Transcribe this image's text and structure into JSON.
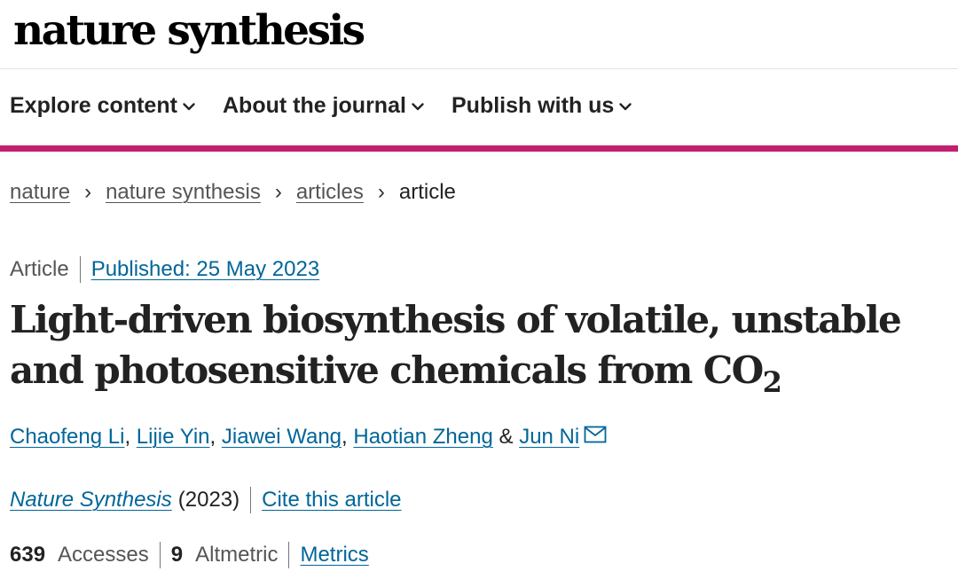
{
  "brand": {
    "logo_text": "nature synthesis"
  },
  "nav": {
    "items": [
      {
        "label": "Explore content",
        "icon": "chevron-down-icon"
      },
      {
        "label": "About the journal",
        "icon": "chevron-down-icon"
      },
      {
        "label": "Publish with us",
        "icon": "chevron-down-icon"
      }
    ]
  },
  "colors": {
    "accent_rule": "#c1206f",
    "link": "#006699",
    "text": "#222222",
    "muted": "#555555"
  },
  "breadcrumb": {
    "items": [
      "nature",
      "nature synthesis",
      "articles"
    ],
    "current": "article",
    "separator": "›"
  },
  "article": {
    "type": "Article",
    "published": "Published: 25 May 2023",
    "title_main": "Light-driven biosynthesis of volatile, unstable and photosensitive chemicals from CO",
    "title_subscript": "2",
    "authors": [
      {
        "name": "Chaofeng Li",
        "after": ","
      },
      {
        "name": "Lijie Yin",
        "after": ","
      },
      {
        "name": "Jiawei Wang",
        "after": ","
      },
      {
        "name": "Haotian Zheng",
        "after": ""
      }
    ],
    "ampersand": "&",
    "corresponding_author": "Jun Ni",
    "corresponding_icon": "mail-icon",
    "journal_name": "Nature Synthesis",
    "year": "(2023)",
    "cite_label": "Cite this article",
    "accesses_count": "639",
    "accesses_label": "Accesses",
    "altmetric_count": "9",
    "altmetric_label": "Altmetric",
    "metrics_label": "Metrics"
  }
}
